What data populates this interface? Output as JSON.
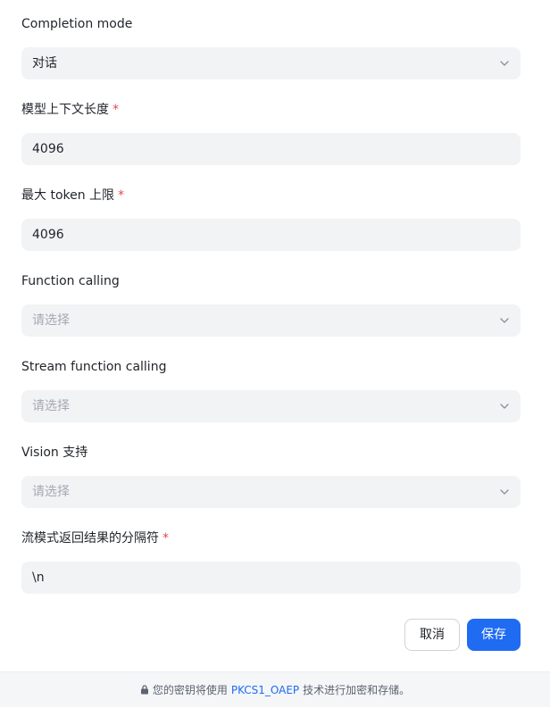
{
  "fields": [
    {
      "label": "Completion mode",
      "required": "",
      "value": "对话",
      "placeholder": ""
    },
    {
      "label": "模型上下文长度",
      "required": "*",
      "value": "4096"
    },
    {
      "label": "最大 token 上限",
      "required": "*",
      "value": "4096"
    },
    {
      "label": "Function calling",
      "required": "",
      "value": "",
      "placeholder": "请选择"
    },
    {
      "label": "Stream function calling",
      "required": "",
      "value": "",
      "placeholder": "请选择"
    },
    {
      "label": "Vision 支持",
      "required": "",
      "value": "",
      "placeholder": "请选择"
    },
    {
      "label": "流模式返回结果的分隔符",
      "required": "*",
      "value": "\\n"
    }
  ],
  "buttons": {
    "cancel_label": "取消",
    "save_label": "保存"
  },
  "notice": {
    "prefix": "您的密钥将使用",
    "link": "PKCS1_OAEP",
    "suffix": "技术进行加密和存储。"
  },
  "colors": {
    "primary": "#1f6bf2",
    "required": "#e5484d",
    "field_bg": "#f2f3f5"
  }
}
